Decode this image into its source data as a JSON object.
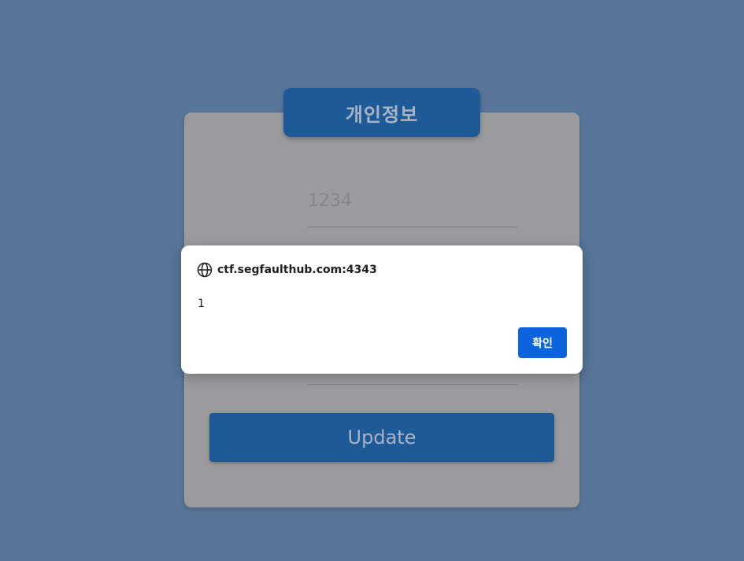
{
  "page": {
    "header_title": "개인정보",
    "field_1_value": "1234",
    "field_2_value": "",
    "update_label": "Update"
  },
  "alert": {
    "origin": "ctf.segfaulthub.com:4343",
    "message": "1",
    "ok_label": "확인",
    "icon": "globe-icon"
  },
  "colors": {
    "background": "#587599",
    "accent": "#1e5a98",
    "alert_button": "#0b63dd"
  }
}
